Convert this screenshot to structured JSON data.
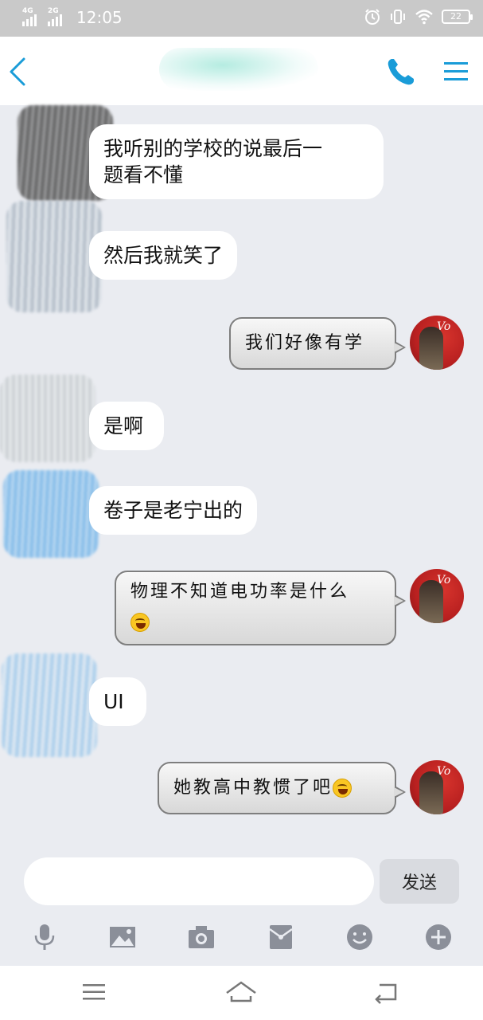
{
  "status_bar": {
    "network1": "4G",
    "network2": "2G",
    "time": "12:05",
    "battery": "22",
    "icons": [
      "alarm-icon",
      "vibrate-icon",
      "wifi-icon",
      "battery-icon"
    ]
  },
  "nav": {
    "icons": [
      "back-icon",
      "phone-icon",
      "menu-icon"
    ],
    "accent": "#1a9cd8"
  },
  "messages": [
    {
      "side": "in",
      "text_line1": "我听别的学校的说最后一",
      "text_line2": "题看不懂"
    },
    {
      "side": "in",
      "text": "然后我就笑了"
    },
    {
      "side": "out",
      "text": "我们好像有学"
    },
    {
      "side": "in",
      "text": "是啊"
    },
    {
      "side": "in",
      "text": "卷子是老宁出的"
    },
    {
      "side": "out",
      "text_line1": "物理不知道电功率是什么",
      "emoji": "laughing-emoji"
    },
    {
      "side": "in",
      "text": "UI"
    },
    {
      "side": "out",
      "text": "她教高中教惯了吧",
      "emoji": "laughing-emoji"
    }
  ],
  "my_avatar_text": "Vo",
  "input": {
    "value": "",
    "send_label": "发送"
  },
  "toolbar_icons": [
    "microphone-icon",
    "image-icon",
    "camera-icon",
    "red-packet-icon",
    "emoji-icon",
    "plus-icon"
  ],
  "system_nav_icons": [
    "menu-lines-icon",
    "home-icon",
    "back-arrow-icon"
  ]
}
